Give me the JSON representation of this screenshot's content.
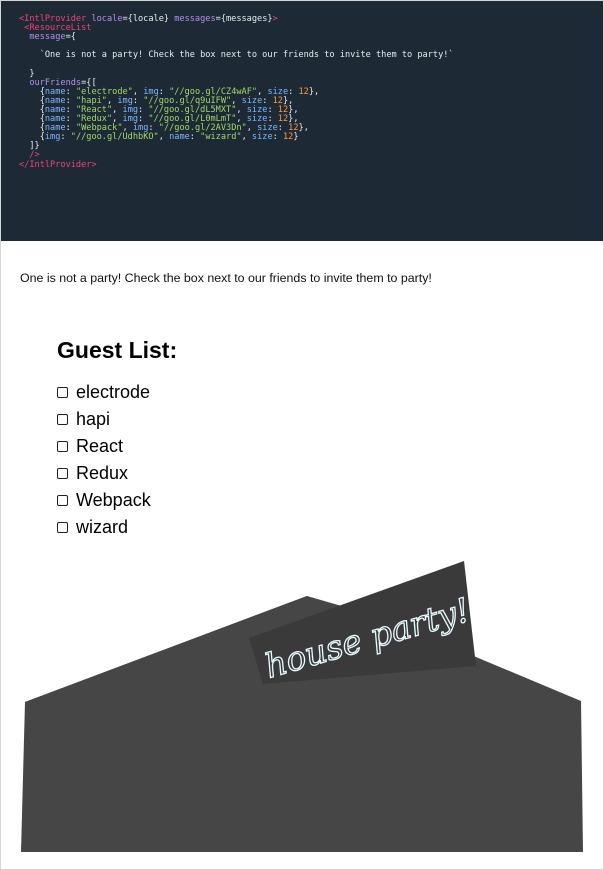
{
  "code": {
    "lines": [
      [
        {
          "t": "<IntlProvider ",
          "c": "tag"
        },
        {
          "t": "locale",
          "c": "attr"
        },
        {
          "t": "={locale} ",
          "c": "plain"
        },
        {
          "t": "messages",
          "c": "attr"
        },
        {
          "t": "={messages}",
          "c": "plain"
        },
        {
          "t": ">",
          "c": "tag"
        }
      ],
      [
        {
          "t": " <ResourceList",
          "c": "tag"
        }
      ],
      [
        {
          "t": "  message",
          "c": "attr"
        },
        {
          "t": "={",
          "c": "plain"
        }
      ],
      [
        {
          "t": "",
          "c": "plain"
        }
      ],
      [
        {
          "t": "    `One is not a party! Check the box next to our friends to invite them to party!`",
          "c": "plain"
        }
      ],
      [
        {
          "t": "",
          "c": "plain"
        }
      ],
      [
        {
          "t": "  }",
          "c": "plain"
        }
      ],
      [
        {
          "t": "  ourFriends",
          "c": "attr"
        },
        {
          "t": "={[",
          "c": "plain"
        }
      ],
      [
        {
          "t": "    {",
          "c": "plain"
        },
        {
          "t": "name",
          "c": "key"
        },
        {
          "t": ": ",
          "c": "plain"
        },
        {
          "t": "\"electrode\"",
          "c": "str"
        },
        {
          "t": ", ",
          "c": "plain"
        },
        {
          "t": "img",
          "c": "key"
        },
        {
          "t": ": ",
          "c": "plain"
        },
        {
          "t": "\"//goo.gl/CZ4wAF\"",
          "c": "str"
        },
        {
          "t": ", ",
          "c": "plain"
        },
        {
          "t": "size",
          "c": "key"
        },
        {
          "t": ": ",
          "c": "plain"
        },
        {
          "t": "12",
          "c": "num"
        },
        {
          "t": "},",
          "c": "plain"
        }
      ],
      [
        {
          "t": "    {",
          "c": "plain"
        },
        {
          "t": "name",
          "c": "key"
        },
        {
          "t": ": ",
          "c": "plain"
        },
        {
          "t": "\"hapi\"",
          "c": "str"
        },
        {
          "t": ", ",
          "c": "plain"
        },
        {
          "t": "img",
          "c": "key"
        },
        {
          "t": ": ",
          "c": "plain"
        },
        {
          "t": "\"//goo.gl/q9uIFW\"",
          "c": "str"
        },
        {
          "t": ", ",
          "c": "plain"
        },
        {
          "t": "size",
          "c": "key"
        },
        {
          "t": ": ",
          "c": "plain"
        },
        {
          "t": "12",
          "c": "num"
        },
        {
          "t": "},",
          "c": "plain"
        }
      ],
      [
        {
          "t": "    {",
          "c": "plain"
        },
        {
          "t": "name",
          "c": "key"
        },
        {
          "t": ": ",
          "c": "plain"
        },
        {
          "t": "\"React\"",
          "c": "str"
        },
        {
          "t": ", ",
          "c": "plain"
        },
        {
          "t": "img",
          "c": "key"
        },
        {
          "t": ": ",
          "c": "plain"
        },
        {
          "t": "\"//goo.gl/dL5MXT\"",
          "c": "str"
        },
        {
          "t": ", ",
          "c": "plain"
        },
        {
          "t": "size",
          "c": "key"
        },
        {
          "t": ": ",
          "c": "plain"
        },
        {
          "t": "12",
          "c": "num"
        },
        {
          "t": "},",
          "c": "plain"
        }
      ],
      [
        {
          "t": "    {",
          "c": "plain"
        },
        {
          "t": "name",
          "c": "key"
        },
        {
          "t": ": ",
          "c": "plain"
        },
        {
          "t": "\"Redux\"",
          "c": "str"
        },
        {
          "t": ", ",
          "c": "plain"
        },
        {
          "t": "img",
          "c": "key"
        },
        {
          "t": ": ",
          "c": "plain"
        },
        {
          "t": "\"//goo.gl/L0mLmT\"",
          "c": "str"
        },
        {
          "t": ", ",
          "c": "plain"
        },
        {
          "t": "size",
          "c": "key"
        },
        {
          "t": ": ",
          "c": "plain"
        },
        {
          "t": "12",
          "c": "num"
        },
        {
          "t": "},",
          "c": "plain"
        }
      ],
      [
        {
          "t": "    {",
          "c": "plain"
        },
        {
          "t": "name",
          "c": "key"
        },
        {
          "t": ": ",
          "c": "plain"
        },
        {
          "t": "\"Webpack\"",
          "c": "str"
        },
        {
          "t": ", ",
          "c": "plain"
        },
        {
          "t": "img",
          "c": "key"
        },
        {
          "t": ": ",
          "c": "plain"
        },
        {
          "t": "\"//goo.gl/2AV3Dn\"",
          "c": "str"
        },
        {
          "t": ", ",
          "c": "plain"
        },
        {
          "t": "size",
          "c": "key"
        },
        {
          "t": ": ",
          "c": "plain"
        },
        {
          "t": "12",
          "c": "num"
        },
        {
          "t": "},",
          "c": "plain"
        }
      ],
      [
        {
          "t": "    {",
          "c": "plain"
        },
        {
          "t": "img",
          "c": "key"
        },
        {
          "t": ": ",
          "c": "plain"
        },
        {
          "t": "\"//goo.gl/UdhbKO\"",
          "c": "str"
        },
        {
          "t": ", ",
          "c": "plain"
        },
        {
          "t": "name",
          "c": "key"
        },
        {
          "t": ": ",
          "c": "plain"
        },
        {
          "t": "\"wizard\"",
          "c": "str"
        },
        {
          "t": ", ",
          "c": "plain"
        },
        {
          "t": "size",
          "c": "key"
        },
        {
          "t": ": ",
          "c": "plain"
        },
        {
          "t": "12",
          "c": "num"
        },
        {
          "t": "}",
          "c": "plain"
        }
      ],
      [
        {
          "t": "  ]}",
          "c": "plain"
        }
      ],
      [
        {
          "t": "  />",
          "c": "tag"
        }
      ],
      [
        {
          "t": "</IntlProvider>",
          "c": "tag"
        }
      ]
    ]
  },
  "message": "One is not a party! Check the box next to our friends to invite them to party!",
  "guest_list": {
    "title": "Guest List:",
    "guests": [
      {
        "name": "electrode",
        "checked": false
      },
      {
        "name": "hapi",
        "checked": false
      },
      {
        "name": "React",
        "checked": false
      },
      {
        "name": "Redux",
        "checked": false
      },
      {
        "name": "Webpack",
        "checked": false
      },
      {
        "name": "wizard",
        "checked": false
      }
    ]
  },
  "house": {
    "sign_text": "house party!",
    "colors": {
      "code_bg": "#1d2a35",
      "house_body": "#464646",
      "roof_back": "#3d3d3d",
      "sign_bg": "#3a3a3a",
      "neon": "#e8fbff"
    }
  }
}
